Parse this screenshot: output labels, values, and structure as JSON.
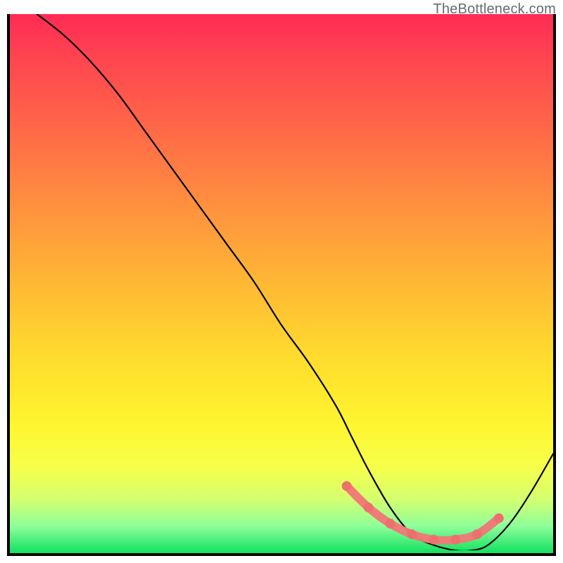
{
  "attribution": "TheBottleneck.com",
  "chart_data": {
    "type": "line",
    "title": "",
    "xlabel": "",
    "ylabel": "",
    "xlim": [
      0,
      100
    ],
    "ylim": [
      0,
      100
    ],
    "series": [
      {
        "name": "bottleneck-curve",
        "x": [
          5,
          10,
          15,
          20,
          25,
          30,
          35,
          40,
          45,
          50,
          55,
          60,
          63,
          66,
          70,
          74,
          78,
          82,
          85,
          88,
          92,
          96,
          100
        ],
        "values": [
          100,
          96,
          91,
          85,
          78,
          71,
          64,
          57,
          50,
          42,
          35,
          27,
          21,
          15,
          8,
          3,
          1,
          0,
          0,
          1,
          5,
          11,
          18
        ]
      }
    ],
    "accent_region": {
      "x": [
        62,
        66,
        70,
        74,
        78,
        82,
        86,
        90
      ],
      "values": [
        12,
        8,
        5,
        3,
        2,
        2,
        3,
        6
      ]
    },
    "gradient_stops": [
      {
        "pos": 0.0,
        "color": "#ff2b55"
      },
      {
        "pos": 0.5,
        "color": "#ffb834"
      },
      {
        "pos": 0.8,
        "color": "#fff52f"
      },
      {
        "pos": 1.0,
        "color": "#10e060"
      }
    ]
  }
}
